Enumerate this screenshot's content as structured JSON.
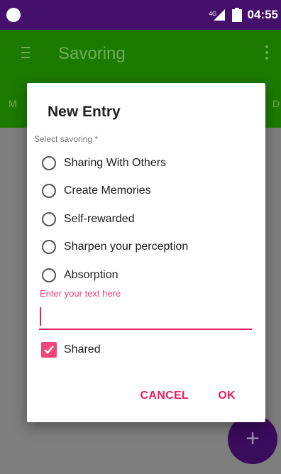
{
  "status_bar": {
    "network": "4G",
    "time": "04:55"
  },
  "app_bar": {
    "title": "Savoring"
  },
  "tabs": {
    "left_partial": "M",
    "right_partial": "D"
  },
  "dialog": {
    "title": "New Entry",
    "field_label": "Select savoring *",
    "options": [
      {
        "label": "Sharing With Others",
        "selected": false
      },
      {
        "label": "Create Memories",
        "selected": false
      },
      {
        "label": "Self-rewarded",
        "selected": false
      },
      {
        "label": "Sharpen your perception",
        "selected": false
      },
      {
        "label": "Absorption",
        "selected": false
      }
    ],
    "text_field": {
      "placeholder": "Enter your text here",
      "value": ""
    },
    "checkbox": {
      "label": "Shared",
      "checked": true
    },
    "buttons": {
      "cancel": "CANCEL",
      "ok": "OK"
    }
  },
  "fab": {
    "label": "+"
  },
  "colors": {
    "status_bar": "#44106c",
    "app_bar": "#1c7a00",
    "accent": "#e91e63",
    "fab": "#3a0c5c"
  }
}
